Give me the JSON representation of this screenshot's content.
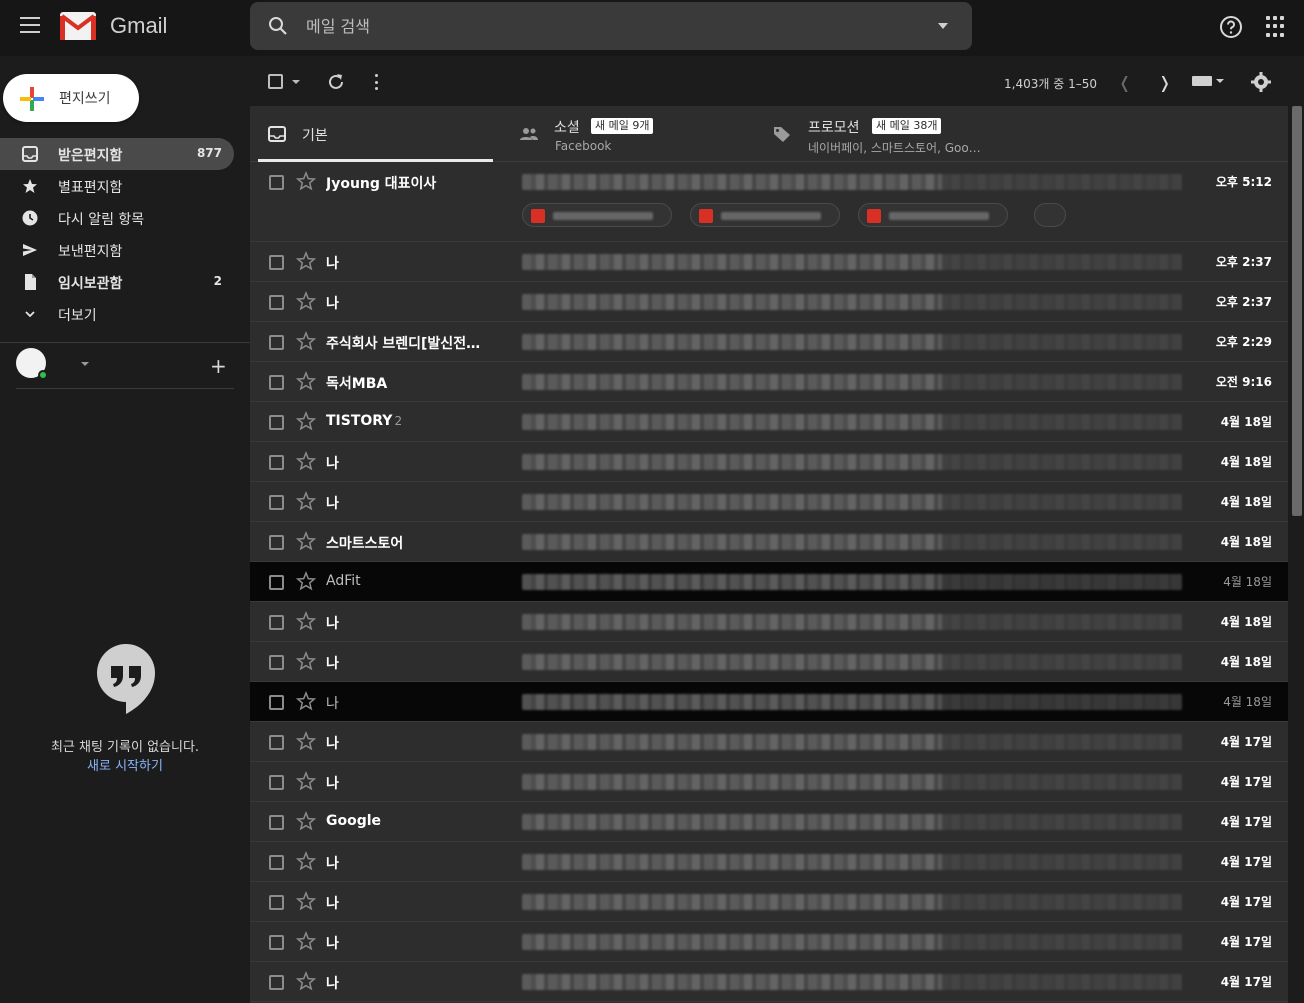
{
  "app": {
    "name": "Gmail",
    "search_placeholder": "메일 검색"
  },
  "sidebar": {
    "compose_label": "편지쓰기",
    "items": [
      {
        "label": "받은편지함",
        "count": "877",
        "icon": "inbox-icon",
        "active": true,
        "bold": true
      },
      {
        "label": "별표편지함",
        "count": "",
        "icon": "star-icon",
        "active": false,
        "bold": false
      },
      {
        "label": "다시 알림 항목",
        "count": "",
        "icon": "clock-icon",
        "active": false,
        "bold": false
      },
      {
        "label": "보낸편지함",
        "count": "",
        "icon": "send-icon",
        "active": false,
        "bold": false
      },
      {
        "label": "임시보관함",
        "count": "2",
        "icon": "draft-icon",
        "active": false,
        "bold": true
      },
      {
        "label": "더보기",
        "count": "",
        "icon": "chevron-down-icon",
        "active": false,
        "bold": false
      }
    ],
    "hangouts": {
      "no_chat": "최근 채팅 기록이 없습니다.",
      "new_chat": "새로 시작하기"
    }
  },
  "toolbar": {
    "page_info": "1,403개 중 1–50"
  },
  "tabs": [
    {
      "name": "기본",
      "badge": "",
      "sub": "",
      "icon": "inbox-tab-icon"
    },
    {
      "name": "소셜",
      "badge": "새 메일 9개",
      "sub": "Facebook",
      "icon": "people-icon"
    },
    {
      "name": "프로모션",
      "badge": "새 메일 38개",
      "sub": "네이버페이, 스마트스토어, Goo…",
      "icon": "tag-icon"
    }
  ],
  "emails": [
    {
      "sender": "Jyoung 대표이사",
      "count": "",
      "date": "오후 5:12",
      "read": false,
      "attachments": true
    },
    {
      "sender": "나",
      "count": "",
      "date": "오후 2:37",
      "read": false,
      "attachments": false
    },
    {
      "sender": "나",
      "count": "",
      "date": "오후 2:37",
      "read": false,
      "attachments": false
    },
    {
      "sender": "주식회사 브렌디[발신전…",
      "count": "",
      "date": "오후 2:29",
      "read": false,
      "attachments": false
    },
    {
      "sender": "독서MBA",
      "count": "",
      "date": "오전 9:16",
      "read": false,
      "attachments": false
    },
    {
      "sender": "TISTORY",
      "count": "2",
      "date": "4월 18일",
      "read": false,
      "attachments": false
    },
    {
      "sender": "나",
      "count": "",
      "date": "4월 18일",
      "read": false,
      "attachments": false
    },
    {
      "sender": "나",
      "count": "",
      "date": "4월 18일",
      "read": false,
      "attachments": false
    },
    {
      "sender": "스마트스토어",
      "count": "",
      "date": "4월 18일",
      "read": false,
      "attachments": false
    },
    {
      "sender": "AdFit",
      "count": "",
      "date": "4월 18일",
      "read": true,
      "attachments": false
    },
    {
      "sender": "나",
      "count": "",
      "date": "4월 18일",
      "read": false,
      "attachments": false
    },
    {
      "sender": "나",
      "count": "",
      "date": "4월 18일",
      "read": false,
      "attachments": false
    },
    {
      "sender": "나",
      "count": "",
      "date": "4월 18일",
      "read": true,
      "attachments": false
    },
    {
      "sender": "나",
      "count": "",
      "date": "4월 17일",
      "read": false,
      "attachments": false
    },
    {
      "sender": "나",
      "count": "",
      "date": "4월 17일",
      "read": false,
      "attachments": false
    },
    {
      "sender": "Google",
      "count": "",
      "date": "4월 17일",
      "read": false,
      "attachments": false
    },
    {
      "sender": "나",
      "count": "",
      "date": "4월 17일",
      "read": false,
      "attachments": false
    },
    {
      "sender": "나",
      "count": "",
      "date": "4월 17일",
      "read": false,
      "attachments": false
    },
    {
      "sender": "나",
      "count": "",
      "date": "4월 17일",
      "read": false,
      "attachments": false
    },
    {
      "sender": "나",
      "count": "",
      "date": "4월 17일",
      "read": false,
      "attachments": false
    }
  ],
  "colors": {
    "accent_link": "#8ab4f8",
    "pdf_red": "#d93025",
    "online_green": "#2fbf4a"
  }
}
